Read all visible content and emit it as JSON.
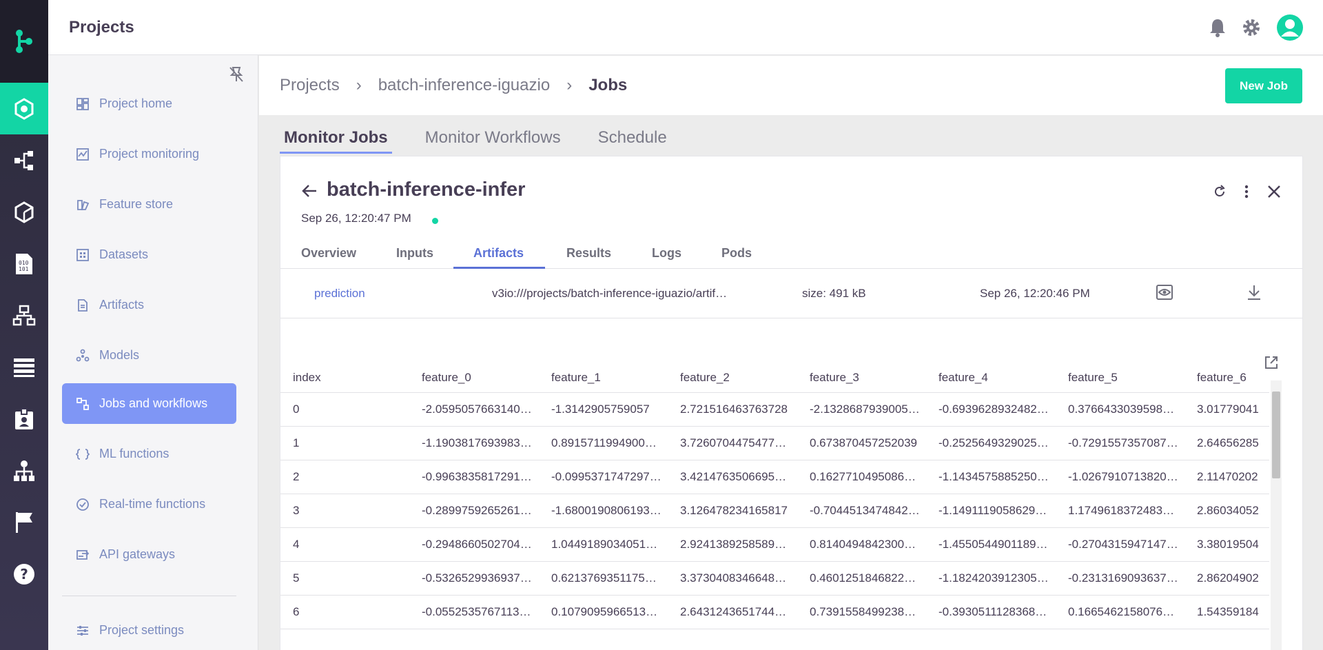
{
  "header": {
    "title": "Projects"
  },
  "sidebar": {
    "items": [
      {
        "label": "Project home",
        "icon": "dashboard-icon"
      },
      {
        "label": "Project monitoring",
        "icon": "monitoring-icon"
      },
      {
        "label": "Feature store",
        "icon": "feature-store-icon"
      },
      {
        "label": "Datasets",
        "icon": "datasets-icon"
      },
      {
        "label": "Artifacts",
        "icon": "artifacts-icon"
      },
      {
        "label": "Models",
        "icon": "models-icon"
      },
      {
        "label": "Jobs and workflows",
        "icon": "jobs-icon"
      },
      {
        "label": "ML functions",
        "icon": "functions-icon"
      },
      {
        "label": "Real-time functions",
        "icon": "realtime-functions-icon"
      },
      {
        "label": "API gateways",
        "icon": "api-gateway-icon"
      }
    ],
    "settings_label": "Project settings",
    "active_index": 6
  },
  "breadcrumb": {
    "root": "Projects",
    "project": "batch-inference-iguazio",
    "current": "Jobs"
  },
  "new_job_label": "New Job",
  "main_tabs": [
    "Monitor Jobs",
    "Monitor Workflows",
    "Schedule"
  ],
  "job": {
    "name": "batch-inference-infer",
    "date": "Sep 26, 12:20:47 PM",
    "tabs": [
      "Overview",
      "Inputs",
      "Artifacts",
      "Results",
      "Logs",
      "Pods"
    ],
    "active_tab": "Artifacts"
  },
  "artifact": {
    "name": "prediction",
    "path": "v3io:///projects/batch-inference-iguazio/artif…",
    "size": "size: 491 kB",
    "date": "Sep 26, 12:20:46 PM"
  },
  "table": {
    "columns": [
      "index",
      "feature_0",
      "feature_1",
      "feature_2",
      "feature_3",
      "feature_4",
      "feature_5",
      "feature_6"
    ],
    "rows": [
      [
        "0",
        "-2.0595057663140…",
        "-1.3142905759057",
        "2.721516463763728",
        "-2.1328687939005…",
        "-0.6939628932482…",
        "0.3766433039598…",
        "3.01779041"
      ],
      [
        "1",
        "-1.1903817693983…",
        "0.8915711994900…",
        "3.7260704475477…",
        "0.673870457252039",
        "-0.2525649329025…",
        "-0.7291557357087…",
        "2.64656285"
      ],
      [
        "2",
        "-0.9963835817291…",
        "-0.0995371747297…",
        "3.4214763506695…",
        "0.1627710495086…",
        "-1.1434575885250…",
        "-1.0267910713820…",
        "2.11470202"
      ],
      [
        "3",
        "-0.2899759265261…",
        "-1.6800190806193…",
        "3.126478234165817",
        "-0.7044513474842…",
        "-1.1491119058629…",
        "1.1749618372483…",
        "2.86034052"
      ],
      [
        "4",
        "-0.2948660502704…",
        "1.0449189034051…",
        "2.9241389258589…",
        "0.8140494842300…",
        "-1.4550544901189…",
        "-0.2704315947147…",
        "3.38019504"
      ],
      [
        "5",
        "-0.5326529936937…",
        "0.6213769351175…",
        "3.3730408346648…",
        "0.4601251846822…",
        "-1.1824203912305…",
        "-0.2313169093637…",
        "2.86204902"
      ],
      [
        "6",
        "-0.0552535767113…",
        "0.1079095966513…",
        "2.6431243651744…",
        "0.7391558499238…",
        "-0.3930511128368…",
        "0.1665462158076…",
        "1.54359184"
      ]
    ]
  },
  "colors": {
    "accent_green": "#13d5a5",
    "accent_blue": "#7f96f5",
    "link": "#5b71d6"
  }
}
